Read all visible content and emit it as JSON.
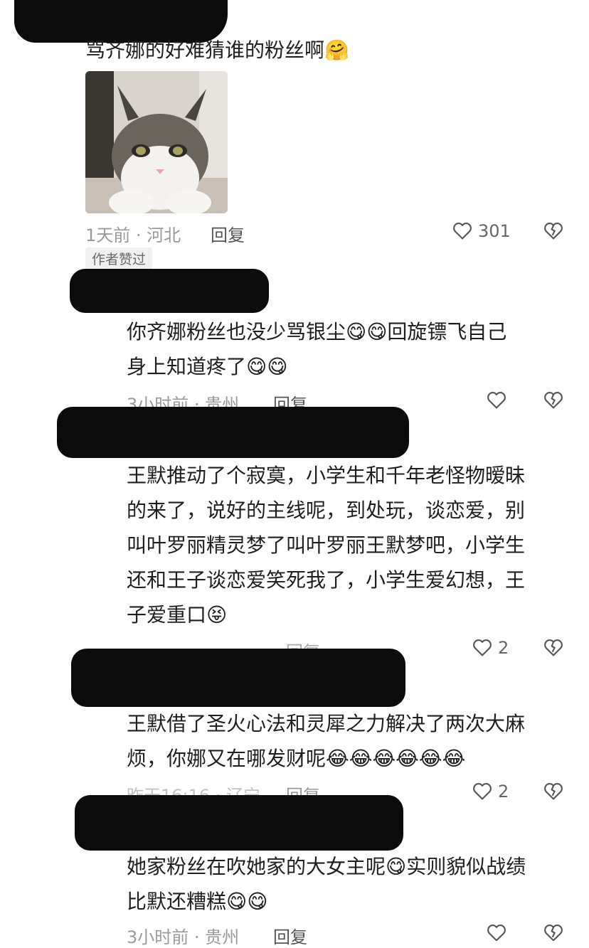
{
  "top_comment": {
    "text": "骂齐娜的好难猜谁的粉丝啊",
    "emoji": "🤗",
    "meta": "1天前 · 河北",
    "reply_label": "回复",
    "likes": "301",
    "badge": "作者赞过"
  },
  "replies": [
    {
      "text": [
        "你齐娜粉丝也没少骂银尘",
        "回旋镖飞自己",
        "身上知道疼了"
      ],
      "emoji": "😋",
      "meta": "3小时前 · 贵州",
      "reply_label": "回复"
    },
    {
      "text": [
        "王默推动了个寂寞，小学生和千年老怪物暧昧",
        "的来了，说好的主线呢，到处玩，谈恋爱，别",
        "叫叶罗丽精灵梦了叫叶罗丽王默梦吧，小学生",
        "还和王子谈恋爱笑死我了，小学生爱幻想，王",
        "子爱重口"
      ],
      "emoji": "😝",
      "reply_label": "回复",
      "likes": "2"
    },
    {
      "text": [
        "王默借了圣火心法和灵犀之力解决了两次大麻",
        "烦，你娜又在哪发财呢"
      ],
      "emoji": "😂",
      "meta": "昨天16:16 · 辽宁",
      "reply_label": "回复",
      "likes": "2"
    },
    {
      "text": [
        "她家粉丝在吹她家的大女主呢",
        "实则貌似战绩",
        "比默还糟糕"
      ],
      "emoji": "😋",
      "meta": "3小时前 · 贵州",
      "reply_label": "回复"
    }
  ],
  "colors": {
    "redaction": "#0b0b0b",
    "meta_gray": "#9a9a9a",
    "text": "#1f1f1f"
  },
  "icons": [
    "heart-outline-icon",
    "broken-heart-icon"
  ]
}
